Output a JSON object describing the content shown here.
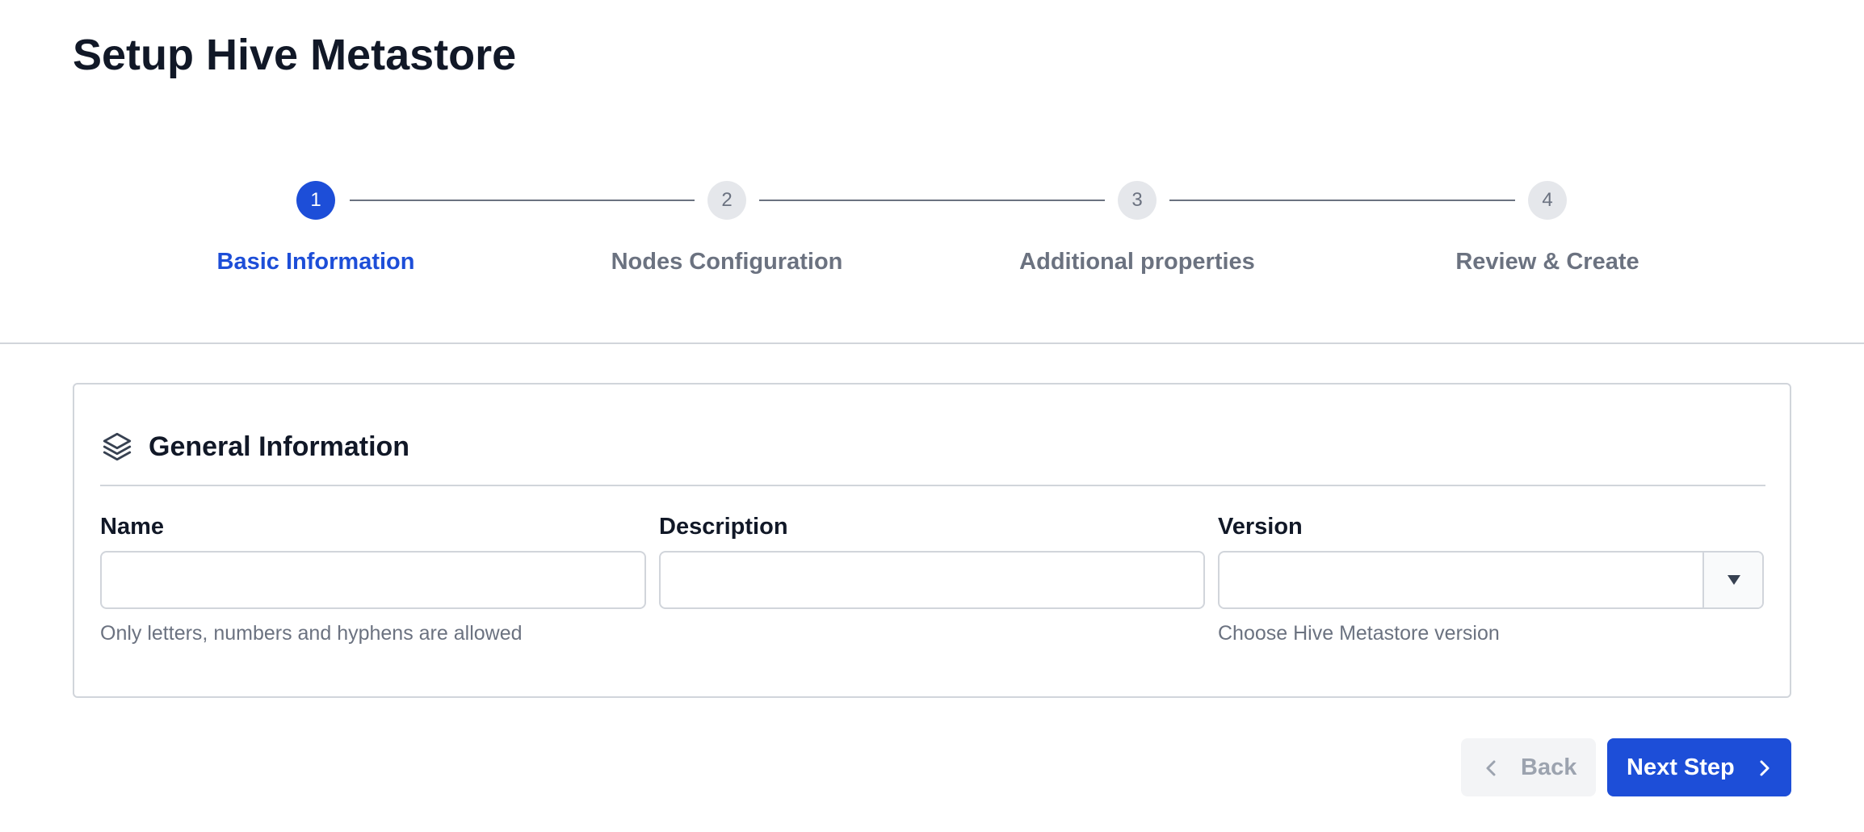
{
  "page": {
    "title": "Setup Hive Metastore"
  },
  "stepper": {
    "steps": [
      {
        "number": "1",
        "label": "Basic Information",
        "state": "active"
      },
      {
        "number": "2",
        "label": "Nodes Configuration",
        "state": "pending"
      },
      {
        "number": "3",
        "label": "Additional properties",
        "state": "pending"
      },
      {
        "number": "4",
        "label": "Review & Create",
        "state": "pending"
      }
    ]
  },
  "card": {
    "icon": "layers-icon",
    "title": "General Information",
    "fields": {
      "name": {
        "label": "Name",
        "value": "",
        "help": "Only letters, numbers and hyphens are allowed"
      },
      "description": {
        "label": "Description",
        "value": ""
      },
      "version": {
        "label": "Version",
        "value": "",
        "toggle_icon": "caret-down-icon",
        "help": "Choose Hive Metastore version"
      }
    }
  },
  "footer": {
    "back_label": "Back",
    "back_icon": "chevron-left-icon",
    "back_disabled": true,
    "next_label": "Next Step",
    "next_icon": "chevron-right-icon"
  },
  "colors": {
    "accent": "#1d4ed8",
    "muted_text": "#6b7280",
    "border": "#d1d5db",
    "heading": "#111827"
  }
}
